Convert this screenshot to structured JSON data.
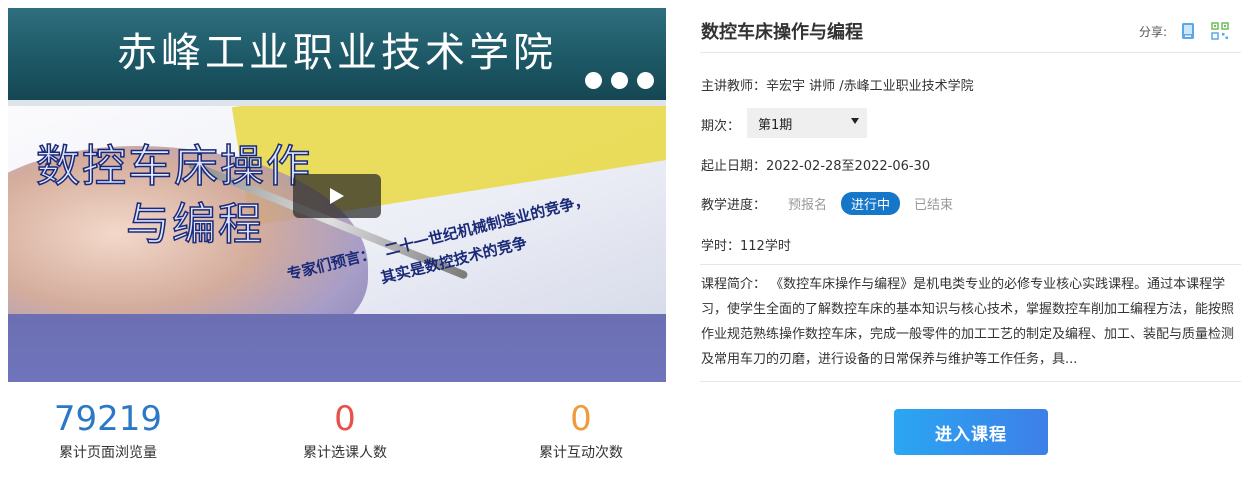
{
  "cover": {
    "banner_title": "赤峰工业职业技术学院",
    "slide_title_line1": "数控车床操作",
    "slide_title_line2": "与编程",
    "quote_line1": "专家们预言：",
    "quote_line2": "二十一世纪机械制造业的竞争，",
    "quote_line3": "其实是数控技术的竞争",
    "play_icon": "play-icon"
  },
  "stats": [
    {
      "value": "79219",
      "label": "累计页面浏览量",
      "color": "#2b78c6"
    },
    {
      "value": "0",
      "label": "累计选课人数",
      "color": "#e8504c"
    },
    {
      "value": "0",
      "label": "累计互动次数",
      "color": "#f09a3e"
    }
  ],
  "course": {
    "title": "数控车床操作与编程",
    "share_label": "分享:",
    "share_icons": [
      "book-icon",
      "qr-code-icon"
    ],
    "teacher": "主讲教师：辛宏宇 讲师 /赤峰工业职业技术学院",
    "term_label": "期次：",
    "term_value": "第1期",
    "dates": "起止日期：2022-02-28至2022-06-30",
    "progress_label": "教学进度：",
    "progress_stages": [
      "预报名",
      "进行中",
      "已结束"
    ],
    "active_stage": "进行中",
    "hours": "学时：112学时",
    "intro": "课程简介：  《数控车床操作与编程》是机电类专业的必修专业核心实践课程。通过本课程学习，使学生全面的了解数控车床的基本知识与核心技术，掌握数控车削加工编程方法，能按照作业规范熟练操作数控车床，完成一般零件的加工工艺的制定及编程、加工、装配与质量检测及常用车刀的刃磨，进行设备的日常保养与维护等工作任务，具...",
    "enter_button": "进入课程"
  },
  "colors": {
    "accent": "#1677c9",
    "button_start": "#2aa6f2",
    "button_end": "#3d7fe8"
  }
}
